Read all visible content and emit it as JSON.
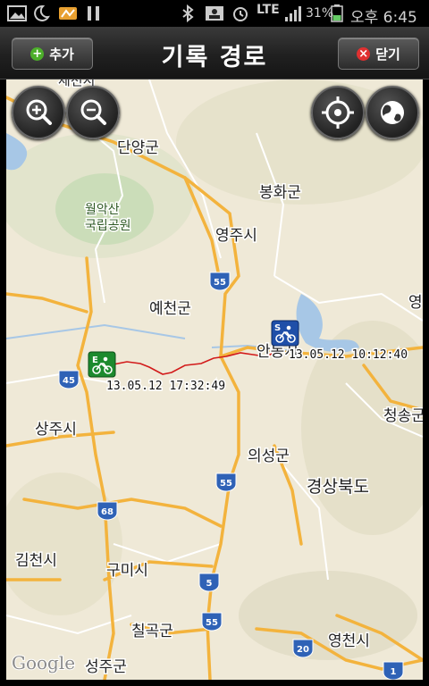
{
  "status_bar": {
    "battery": "31%",
    "network": "LTE",
    "time": "오후 6:45"
  },
  "header": {
    "title": "기록 경로",
    "add_label": "추가",
    "close_label": "닫기"
  },
  "map": {
    "labels": {
      "danyang": "단양군",
      "bonghwa": "봉화군",
      "woraksan_1": "월악산",
      "woraksan_2": "국립공원",
      "yeongju": "영주시",
      "yecheon": "예천군",
      "andong": "안동시",
      "sangju": "상주시",
      "uiseong": "의성군",
      "gyeongbuk": "경상북도",
      "gimcheon": "김천시",
      "gumi": "구미시",
      "chilgok": "칠곡군",
      "seongju": "성주군",
      "yeongcheon": "영천시",
      "cheongsong": "청송군",
      "yeong_edge": "영",
      "jecheon_top": "제천시"
    },
    "road_shields": [
      "55",
      "45",
      "55",
      "68",
      "5",
      "55",
      "20",
      "1"
    ],
    "start_marker_time": "13.05.12 10:12:40",
    "end_marker_time": "13.05.12 17:32:49",
    "start_marker_letter": "S",
    "end_marker_letter": "E",
    "google_logo": "Google"
  }
}
